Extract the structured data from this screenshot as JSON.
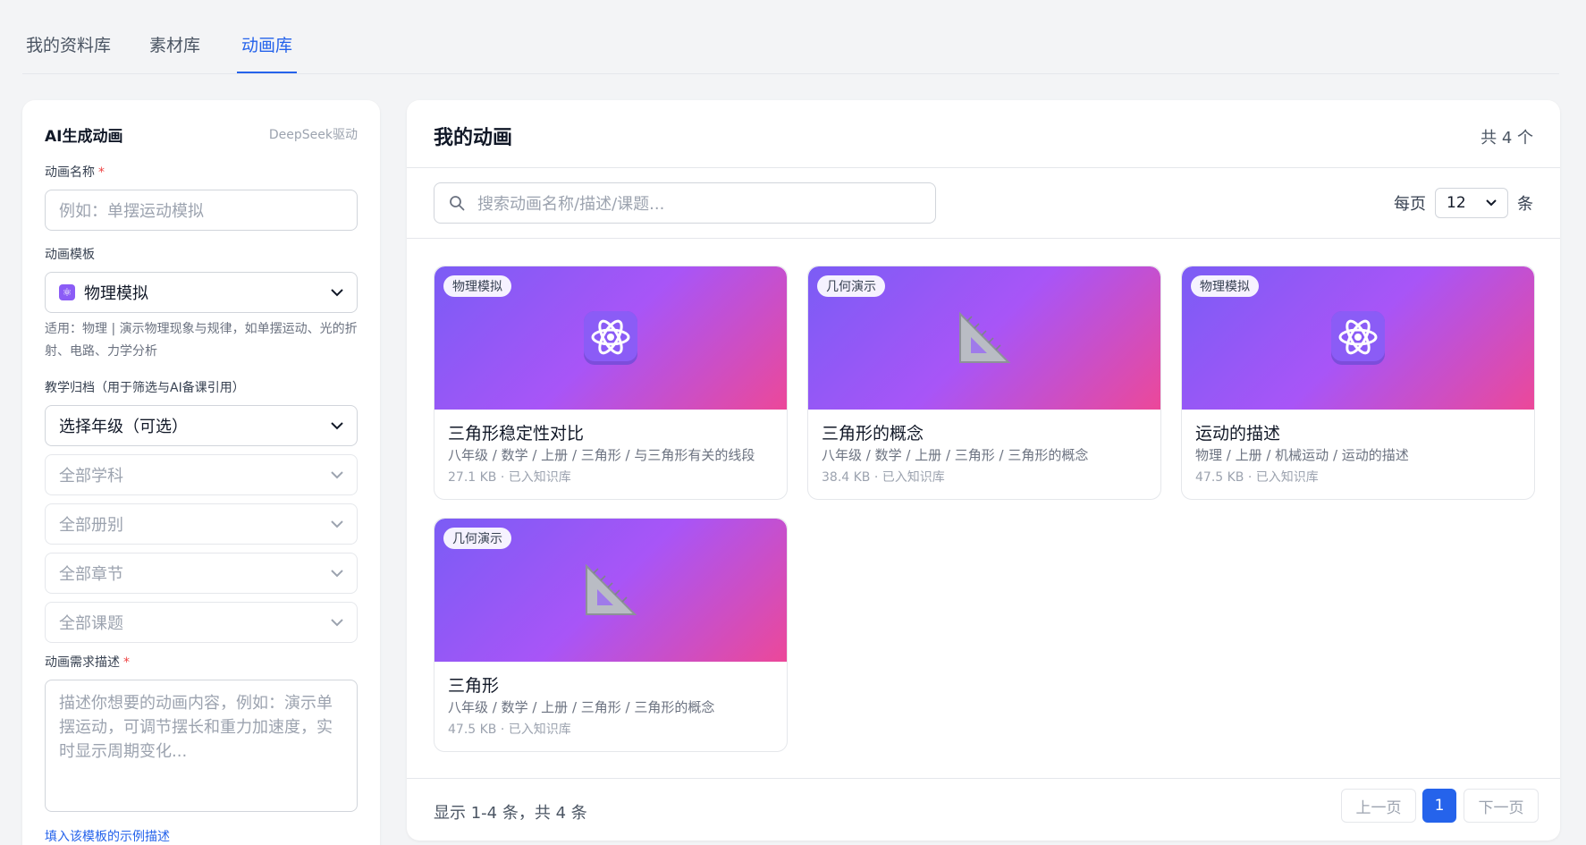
{
  "tabs": [
    {
      "label": "我的资料库"
    },
    {
      "label": "素材库"
    },
    {
      "label": "动画库"
    }
  ],
  "left": {
    "title": "AI生成动画",
    "badge": "DeepSeek驱动",
    "name_label": "动画名称",
    "required_mark": "*",
    "name_placeholder": "例如：单摆运动模拟",
    "template_label": "动画模板",
    "template_icon": "⚛",
    "template_value": "物理模拟",
    "template_hint": "适用：物理 | 演示物理现象与规律，如单摆运动、光的折射、电路、力学分析",
    "archive_label": "教学归档（用于筛选与AI备课引用）",
    "grade_value": "选择年级（可选）",
    "subject_value": "全部学科",
    "volume_value": "全部册别",
    "chapter_value": "全部章节",
    "topic_value": "全部课题",
    "desc_label": "动画需求描述",
    "desc_placeholder": "描述你想要的动画内容，例如：演示单摆运动，可调节摆长和重力加速度，实时显示周期变化...",
    "example_link": "填入该模板的示例描述"
  },
  "right": {
    "title": "我的动画",
    "count": "共 4 个",
    "search_placeholder": "搜索动画名称/描述/课题...",
    "per_page_prefix": "每页",
    "per_page_value": "12",
    "per_page_suffix": "条",
    "cards": [
      {
        "tag": "物理模拟",
        "icon": "atom-icon",
        "title": "三角形稳定性对比",
        "path": "八年级 / 数学 / 上册 / 三角形 / 与三角形有关的线段",
        "meta": "27.1 KB · 已入知识库"
      },
      {
        "tag": "几何演示",
        "icon": "triangle-ruler-icon",
        "title": "三角形的概念",
        "path": "八年级 / 数学 / 上册 / 三角形 / 三角形的概念",
        "meta": "38.4 KB · 已入知识库"
      },
      {
        "tag": "物理模拟",
        "icon": "atom-icon",
        "title": "运动的描述",
        "path": "物理 / 上册 / 机械运动 / 运动的描述",
        "meta": "47.5 KB · 已入知识库"
      },
      {
        "tag": "几何演示",
        "icon": "triangle-ruler-icon",
        "title": "三角形",
        "path": "八年级 / 数学 / 上册 / 三角形 / 三角形的概念",
        "meta": "47.5 KB · 已入知识库"
      }
    ],
    "footer_text": "显示 1-4 条，共 4 条",
    "prev_label": "上一页",
    "current_page": "1",
    "next_label": "下一页"
  },
  "colors": {
    "accent": "#2563eb",
    "required": "#ef4444",
    "thumb_start": "#7b5cf5",
    "thumb_end": "#ec4899"
  }
}
